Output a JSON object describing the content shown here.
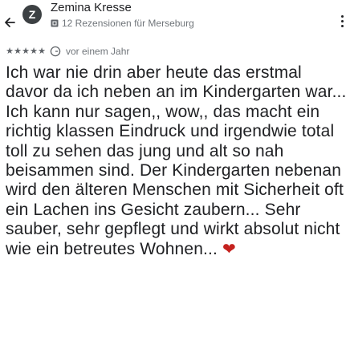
{
  "header": {
    "back_icon": "arrow-left-icon",
    "avatar_letter": "Z",
    "author_name": "Zemina Kresse",
    "author_meta": "12 Rezensionen für Merseburg",
    "guide_icon": "local-guide-icon",
    "more_icon": "more-vertical-icon"
  },
  "rating": {
    "stars": 5,
    "max_stars": 5,
    "source_icon": "google-icon",
    "time": "vor einem Jahr"
  },
  "review": {
    "text": "Ich war nie drin aber heute das erstmal davor da ich neben an im Kindergarten war... Ich kann nur sagen,, wow,, das macht ein richtig klassen Eindruck und irgendwie total toll zu sehen das jung und alt so nah beisammen sind. Der Kindergarten nebenan wird den älteren Menschen mit Sicherheit oft ein Lachen ins Gesicht zaubern... Sehr sauber, sehr gepflegt und wirkt absolut nicht wie ein betreutes Wohnen...",
    "emoji": "❤"
  },
  "colors": {
    "text_primary": "#202124",
    "text_secondary": "#70757a",
    "heart": "#c5221f",
    "avatar_bg": "#3c4043"
  }
}
